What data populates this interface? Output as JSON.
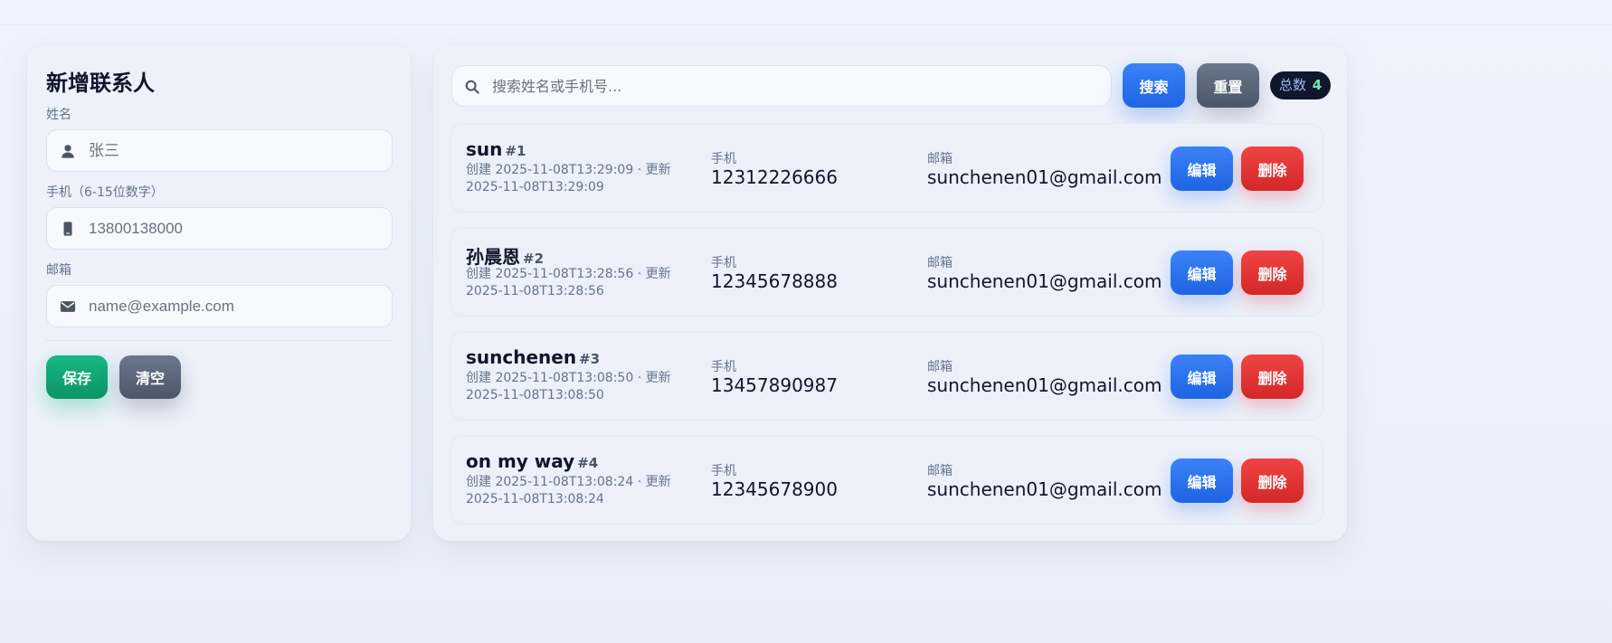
{
  "form": {
    "title": "新增联系人",
    "name_label": "姓名",
    "name_placeholder": "张三",
    "phone_label": "手机（6-15位数字）",
    "phone_placeholder": "13800138000",
    "email_label": "邮箱",
    "email_placeholder": "name@example.com",
    "save_label": "保存",
    "clear_label": "清空"
  },
  "toolbar": {
    "search_placeholder": "搜索姓名或手机号...",
    "search_label": "搜索",
    "reset_label": "重置",
    "total_label": "总数",
    "total_count": "4"
  },
  "list": {
    "phone_label": "手机",
    "email_label": "邮箱",
    "edit_label": "编辑",
    "delete_label": "删除",
    "contacts": [
      {
        "name": "sun",
        "id": "#1",
        "meta": "创建 2025-11-08T13:29:09 · 更新 2025-11-08T13:29:09",
        "phone": "12312226666",
        "email": "sunchenen01@gmail.com"
      },
      {
        "name": "孙晨恩",
        "id": "#2",
        "meta": "创建 2025-11-08T13:28:56 · 更新 2025-11-08T13:28:56",
        "phone": "12345678888",
        "email": "sunchenen01@gmail.com"
      },
      {
        "name": "sunchenen",
        "id": "#3",
        "meta": "创建 2025-11-08T13:08:50 · 更新 2025-11-08T13:08:50",
        "phone": "13457890987",
        "email": "sunchenen01@gmail.com"
      },
      {
        "name": "on my way",
        "id": "#4",
        "meta": "创建 2025-11-08T13:08:24 · 更新 2025-11-08T13:08:24",
        "phone": "12345678900",
        "email": "sunchenen01@gmail.com"
      }
    ]
  },
  "icons": {
    "user": "user-icon",
    "phone": "phone-icon",
    "mail": "mail-icon",
    "search": "search-icon"
  },
  "colors": {
    "primary": "#2563eb",
    "success": "#10b981",
    "danger": "#dc2626",
    "neutral": "#475569",
    "badge_bg": "#0f172a"
  }
}
